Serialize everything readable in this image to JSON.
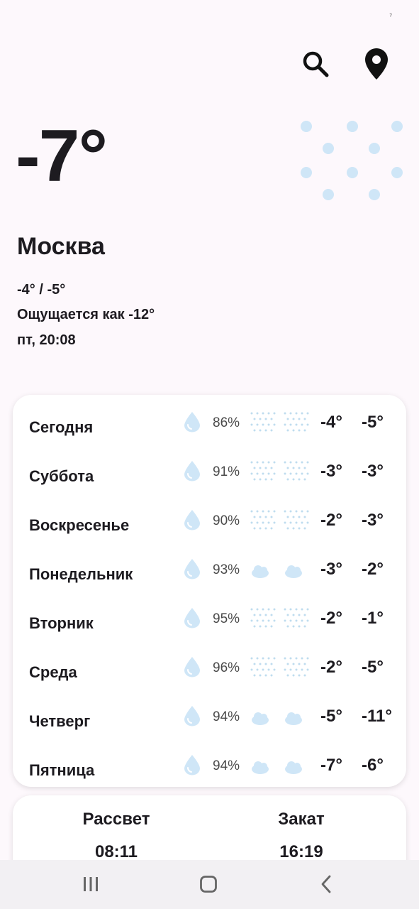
{
  "header": {
    "search_icon": "search-icon",
    "location_icon": "location-pin-icon"
  },
  "current": {
    "temp": "-7°",
    "icon": "snow-icon",
    "city": "Москва",
    "range": "-4° / -5°",
    "feels": "Ощущается как -12°",
    "datetime": "пт, 20:08"
  },
  "colors": {
    "accent_snow": "#cfe6f7",
    "background": "#fdf8fc",
    "card": "#ffffff",
    "text": "#1d1b20"
  },
  "forecast": [
    {
      "day": "Сегодня",
      "humidity": "86%",
      "day_icon": "snow",
      "night_icon": "snow",
      "hi": "-4°",
      "lo": "-5°"
    },
    {
      "day": "Суббота",
      "humidity": "91%",
      "day_icon": "snow",
      "night_icon": "snow",
      "hi": "-3°",
      "lo": "-3°"
    },
    {
      "day": "Воскресенье",
      "humidity": "90%",
      "day_icon": "snow",
      "night_icon": "snow",
      "hi": "-2°",
      "lo": "-3°"
    },
    {
      "day": "Понедельник",
      "humidity": "93%",
      "day_icon": "cloud-night",
      "night_icon": "cloud-night",
      "hi": "-3°",
      "lo": "-2°"
    },
    {
      "day": "Вторник",
      "humidity": "95%",
      "day_icon": "snow",
      "night_icon": "snow",
      "hi": "-2°",
      "lo": "-1°"
    },
    {
      "day": "Среда",
      "humidity": "96%",
      "day_icon": "snow",
      "night_icon": "snow",
      "hi": "-2°",
      "lo": "-5°"
    },
    {
      "day": "Четверг",
      "humidity": "94%",
      "day_icon": "cloud-night",
      "night_icon": "cloud-night",
      "hi": "-5°",
      "lo": "-11°"
    },
    {
      "day": "Пятница",
      "humidity": "94%",
      "day_icon": "cloud-night",
      "night_icon": "cloud-night",
      "hi": "-7°",
      "lo": "-6°"
    }
  ],
  "sun": {
    "sunrise_label": "Рассвет",
    "sunrise": "08:11",
    "sunset_label": "Закат",
    "sunset": "16:19"
  },
  "nav": {
    "recents_icon": "recents-icon",
    "home_icon": "home-icon",
    "back_icon": "back-icon"
  }
}
